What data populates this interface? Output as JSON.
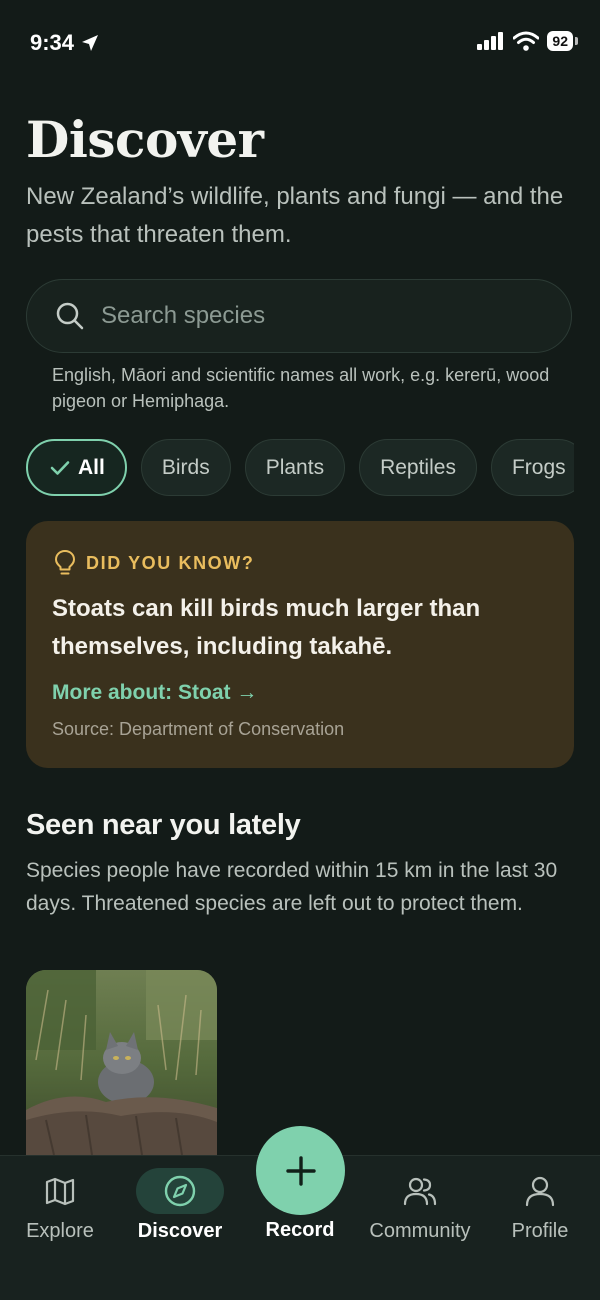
{
  "status_bar": {
    "time": "9:34",
    "battery": "92"
  },
  "header": {
    "title": "Discover",
    "subtitle": "New Zealand’s wildlife, plants and fungi — and the pests that threaten them."
  },
  "search": {
    "placeholder": "Search species",
    "hint": "English, Māori and scientific names all work, e.g. kererū, wood pigeon or Hemiphaga."
  },
  "filters": {
    "chips": [
      {
        "label": "All",
        "selected": true
      },
      {
        "label": "Birds",
        "selected": false
      },
      {
        "label": "Plants",
        "selected": false
      },
      {
        "label": "Reptiles",
        "selected": false
      },
      {
        "label": "Frogs",
        "selected": false
      }
    ]
  },
  "fact_card": {
    "heading": "DID YOU KNOW?",
    "text": "Stoats can kill birds much larger than themselves, including takahē.",
    "link": "More about: Stoat →",
    "source": "Source: Department of Conservation"
  },
  "nearby": {
    "title": "Seen near you lately",
    "description": "Species people have recorded within 15 km in the last 30 days. Threatened species are left out to protect them."
  },
  "bottom_nav": {
    "items": [
      {
        "label": "Explore",
        "icon": "map-icon"
      },
      {
        "label": "Discover",
        "icon": "compass-icon",
        "active": true
      },
      {
        "label": "Record",
        "icon": "plus-icon"
      },
      {
        "label": "Community",
        "icon": "people-icon"
      },
      {
        "label": "Profile",
        "icon": "person-icon"
      }
    ]
  },
  "colors": {
    "background": "#131b18",
    "accent": "#7fd1ad",
    "fact_card_bg": "#3a311d",
    "fact_heading": "#e9bd5e"
  }
}
